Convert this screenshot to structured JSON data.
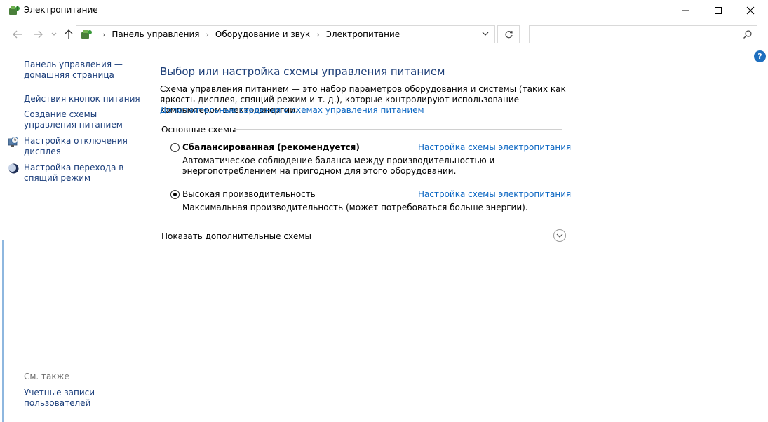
{
  "window": {
    "title": "Электропитание",
    "minimize_icon": "minimize-icon",
    "maximize_icon": "maximize-icon",
    "close_icon": "close-icon"
  },
  "nav": {
    "breadcrumbs": [
      "Панель управления",
      "Оборудование и звук",
      "Электропитание"
    ],
    "search_value": "",
    "search_placeholder": ""
  },
  "sidebar": {
    "items": [
      {
        "label": "Панель управления — домашняя страница"
      },
      {
        "label": "Действия кнопок питания"
      },
      {
        "label": "Создание схемы управления питанием"
      },
      {
        "label": "Настройка отключения дисплея"
      },
      {
        "label": "Настройка перехода в спящий режим"
      }
    ],
    "see_also_label": "См. также",
    "see_also_items": [
      {
        "label": "Учетные записи пользователей"
      }
    ]
  },
  "main": {
    "title": "Выбор или настройка схемы управления питанием",
    "description": "Схема управления питанием — это набор параметров оборудования и системы (таких как яркость дисплея, спящий режим и т. д.), которые контролируют использование компьютером электроэнергии.",
    "more_info_link": "Дополнительные сведения о схемах управления питанием",
    "group_label": "Основные схемы",
    "plans": [
      {
        "name": "Сбалансированная (рекомендуется)",
        "selected": false,
        "link": "Настройка схемы электропитания",
        "description": "Автоматическое соблюдение баланса между производительностью и энергопотреблением на пригодном для этого оборудовании."
      },
      {
        "name": "Высокая производительность",
        "selected": true,
        "link": "Настройка схемы электропитания",
        "description": "Максимальная производительность (может потребоваться больше энергии)."
      }
    ],
    "show_more_label": "Показать дополнительные схемы"
  },
  "help": {
    "label": "?"
  },
  "colors": {
    "link": "#0b66c2",
    "title": "#1e3f78",
    "sidebar_link": "#1a3d7a",
    "help_bg": "#1e6fbf"
  }
}
